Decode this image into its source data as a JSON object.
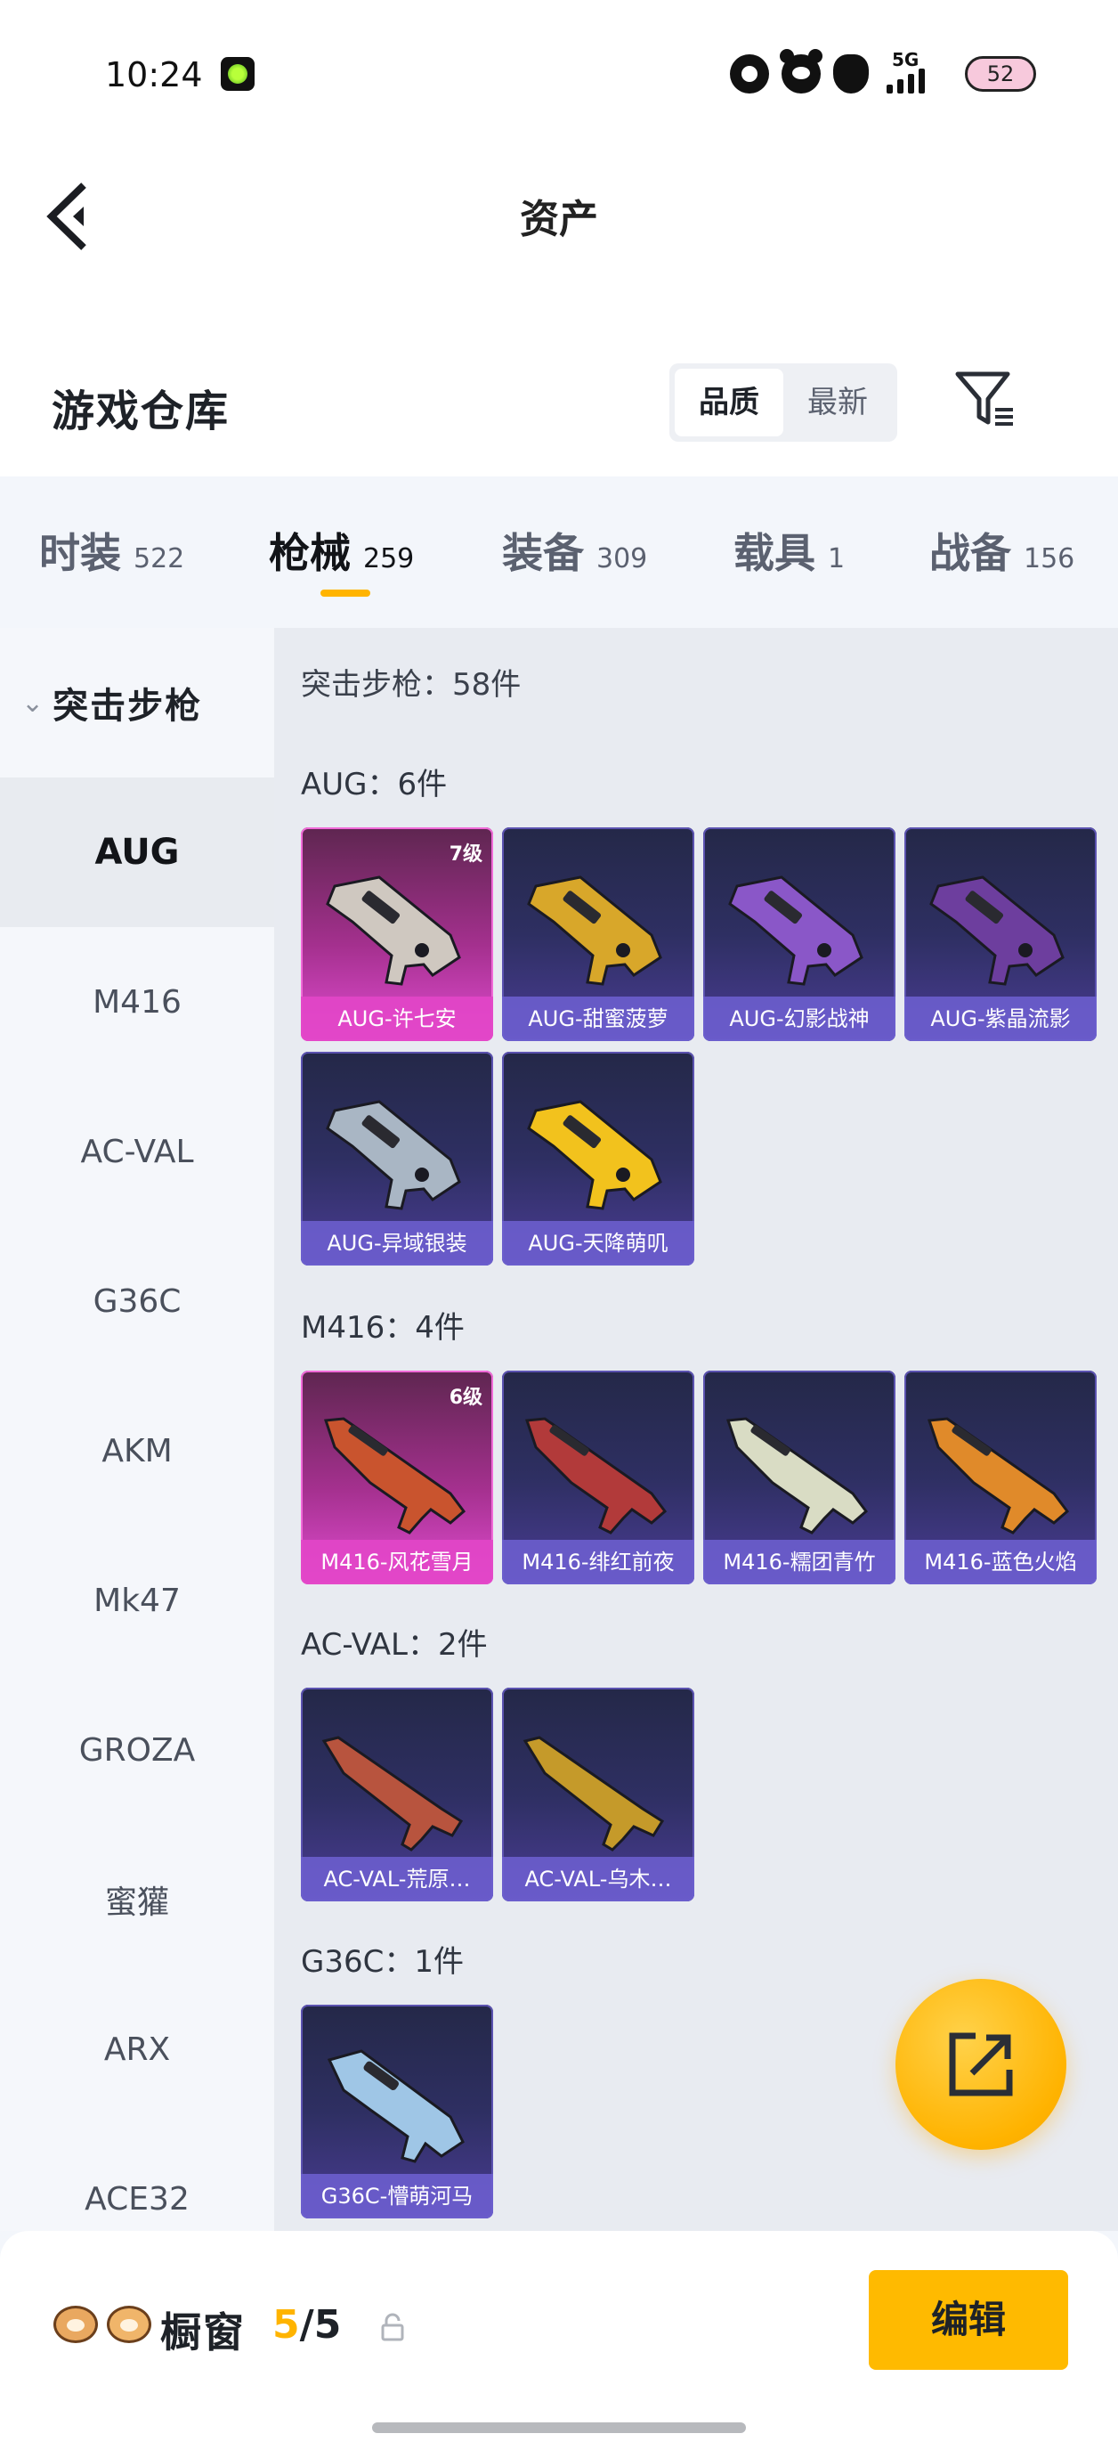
{
  "status_bar": {
    "time": "10:24",
    "network": "5G",
    "battery": "52"
  },
  "header": {
    "title": "资产"
  },
  "warehouse": {
    "title": "游戏仓库",
    "sort_options": [
      "品质",
      "最新"
    ],
    "active_sort": "品质"
  },
  "category_tabs": [
    {
      "label": "时装",
      "count": "522"
    },
    {
      "label": "枪械",
      "count": "259",
      "active": true
    },
    {
      "label": "装备",
      "count": "309"
    },
    {
      "label": "载具",
      "count": "1"
    },
    {
      "label": "战备",
      "count": "156"
    }
  ],
  "sidebar": {
    "group_label": "突击步枪",
    "items": [
      "AUG",
      "M416",
      "AC-VAL",
      "G36C",
      "AKM",
      "Mk47",
      "GROZA",
      "蜜獾",
      "ARX",
      "ACE32"
    ],
    "active_item": "AUG"
  },
  "content": {
    "total_label": "突击步枪：58件",
    "sections": [
      {
        "label": "AUG：6件",
        "items": [
          {
            "name": "AUG-许七安",
            "tier": "7级",
            "rarity": "legendary",
            "gun_color": "#cfc8c0"
          },
          {
            "name": "AUG-甜蜜菠萝",
            "rarity": "epic",
            "gun_color": "#d8a72a"
          },
          {
            "name": "AUG-幻影战神",
            "rarity": "epic",
            "gun_color": "#8a57c8"
          },
          {
            "name": "AUG-紫晶流影",
            "rarity": "epic",
            "gun_color": "#6d3e9e"
          },
          {
            "name": "AUG-异域银装",
            "rarity": "epic",
            "gun_color": "#a9b6c4"
          },
          {
            "name": "AUG-天降萌叽",
            "rarity": "epic",
            "gun_color": "#f2c21d"
          }
        ]
      },
      {
        "label": "M416：4件",
        "items": [
          {
            "name": "M416-风花雪月",
            "tier": "6级",
            "rarity": "legendary",
            "gun_color": "#c9542e"
          },
          {
            "name": "M416-绯红前夜",
            "rarity": "epic",
            "gun_color": "#b23a3a"
          },
          {
            "name": "M416-糯团青竹",
            "rarity": "epic",
            "gun_color": "#d9dcc4"
          },
          {
            "name": "M416-蓝色火焰",
            "rarity": "epic",
            "gun_color": "#e08a2a"
          }
        ]
      },
      {
        "label": "AC-VAL：2件",
        "items": [
          {
            "name": "AC-VAL-荒原…",
            "rarity": "epic",
            "gun_color": "#b8543e"
          },
          {
            "name": "AC-VAL-乌木…",
            "rarity": "epic",
            "gun_color": "#c59a2a"
          }
        ]
      },
      {
        "label": "G36C：1件",
        "items": [
          {
            "name": "G36C-懵萌河马",
            "rarity": "epic",
            "gun_color": "#9fc6e6"
          }
        ]
      }
    ]
  },
  "bottom_bar": {
    "showcase_label": "橱窗",
    "showcase_current": "5",
    "showcase_total": "/5",
    "edit_label": "编辑"
  },
  "colors": {
    "accent": "#ffb400",
    "legendary": "#e04cd0",
    "epic": "#4a3c94"
  }
}
